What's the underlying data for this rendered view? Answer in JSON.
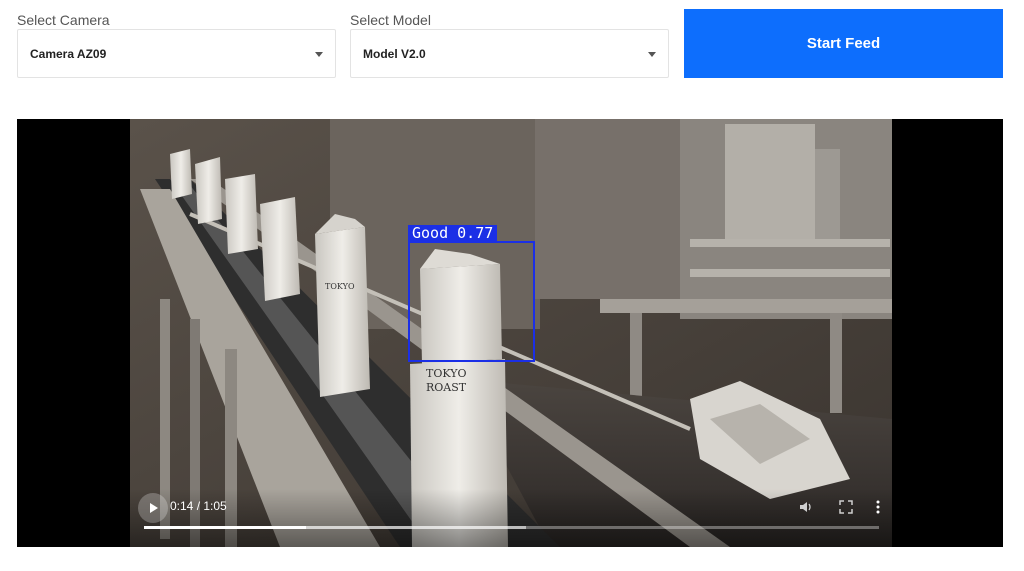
{
  "camera": {
    "label": "Select Camera",
    "value": "Camera AZ09"
  },
  "model": {
    "label": "Select Model",
    "value": "Model V2.0"
  },
  "start_button": {
    "label": "Start Feed",
    "color": "#0d6efd"
  },
  "video": {
    "package_text": [
      "TOKYO",
      "ROAST"
    ],
    "detection": {
      "label": "Good 0.77",
      "color": "#1b2fe6"
    },
    "player": {
      "time": "0:14 / 1:05",
      "progress": 0.22,
      "buffered": 0.52,
      "icons": [
        "play-icon",
        "volume-icon",
        "fullscreen-icon",
        "more-options-icon"
      ]
    }
  }
}
